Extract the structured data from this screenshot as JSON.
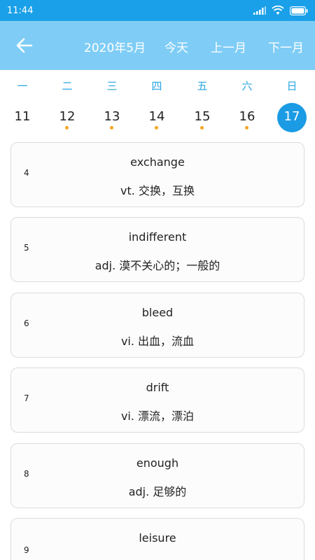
{
  "status": {
    "time": "11:44",
    "icons": [
      "signal-icon",
      "wifi-icon",
      "battery-icon"
    ]
  },
  "header": {
    "back_icon": "arrow-left-icon",
    "month": "2020年5月",
    "today": "今天",
    "prev_month": "上一月",
    "next_month": "下一月"
  },
  "weekdays": [
    "一",
    "二",
    "三",
    "四",
    "五",
    "六",
    "日"
  ],
  "dates": [
    {
      "day": "11",
      "has_dot": false,
      "selected": false
    },
    {
      "day": "12",
      "has_dot": true,
      "selected": false
    },
    {
      "day": "13",
      "has_dot": true,
      "selected": false
    },
    {
      "day": "14",
      "has_dot": true,
      "selected": false
    },
    {
      "day": "15",
      "has_dot": true,
      "selected": false
    },
    {
      "day": "16",
      "has_dot": true,
      "selected": false
    },
    {
      "day": "17",
      "has_dot": false,
      "selected": true
    }
  ],
  "words": [
    {
      "index": "4",
      "word": "exchange",
      "meaning": "vt. 交换，互换"
    },
    {
      "index": "5",
      "word": "indifferent",
      "meaning": "adj. 漠不关心的；一般的"
    },
    {
      "index": "6",
      "word": "bleed",
      "meaning": "vi. 出血，流血"
    },
    {
      "index": "7",
      "word": "drift",
      "meaning": "vi. 漂流，漂泊"
    },
    {
      "index": "8",
      "word": "enough",
      "meaning": "adj. 足够的"
    },
    {
      "index": "9",
      "word": "leisure",
      "meaning": ""
    }
  ],
  "colors": {
    "status_bar": "#1aa0e8",
    "app_bar": "#7fcdf6",
    "weekday_text": "#29a6e2",
    "selected_date": "#1a9be4",
    "dot": "#f5a623"
  }
}
